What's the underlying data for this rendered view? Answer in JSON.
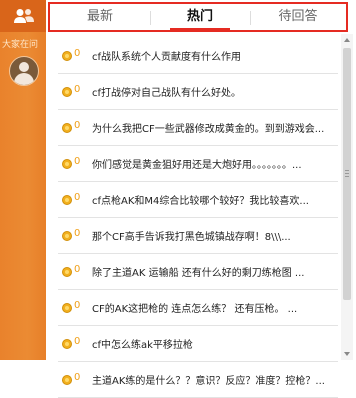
{
  "sidebar": {
    "label": "大家在问"
  },
  "tabs": [
    {
      "label": "最新"
    },
    {
      "label": "热门"
    },
    {
      "label": "待回答"
    }
  ],
  "items": [
    {
      "count": "0",
      "title": "cf战队系统个人贡献度有什么作用"
    },
    {
      "count": "0",
      "title": "cf打战停对自己战队有什么好处。"
    },
    {
      "count": "0",
      "title": "为什么我把CF一些武器修改成黄金的。到到游戏会..."
    },
    {
      "count": "0",
      "title": "你们感觉是黄金狙好用还是大炮好用。。。。。。。..."
    },
    {
      "count": "0",
      "title": "cf点枪AK和M4综合比较哪个较好？我比较喜欢..."
    },
    {
      "count": "0",
      "title": "那个CF高手告诉我打黑色城镇战存啊！8\\\\\\..."
    },
    {
      "count": "0",
      "title": "除了主道AK 运输船 还有什么好的剩刀练枪图 ..."
    },
    {
      "count": "0",
      "title": "CF的AK这把枪的 连点怎么练？ 还有压枪。 ..."
    },
    {
      "count": "0",
      "title": "cf中怎么练ak平移拉枪"
    },
    {
      "count": "0",
      "title": "主道AK练的是什么？？意识？反应？准度？控枪？..."
    }
  ]
}
